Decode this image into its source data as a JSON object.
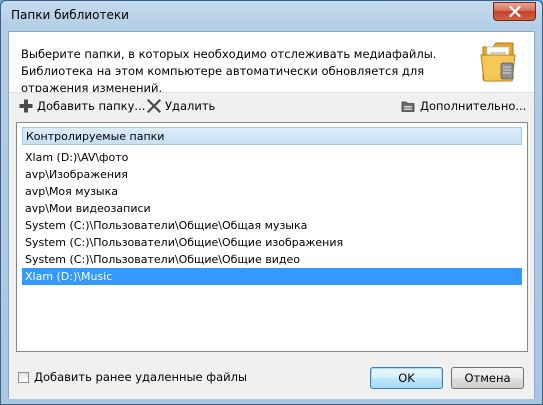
{
  "window": {
    "title": "Папки библиотеки"
  },
  "header": {
    "description": "Выберите папки, в которых необходимо отслеживать медиафайлы. Библиотека на этом компьютере автоматически обновляется для отражения изменений."
  },
  "toolbar": {
    "add_label": "Добавить папку...",
    "remove_label": "Удалить",
    "advanced_label": "Дополнительно..."
  },
  "list": {
    "header": "Контролируемые папки",
    "items": [
      "Xlam (D:)\\AV\\фото",
      "avp\\Изображения",
      "avp\\Моя музыка",
      "avp\\Мои видеозаписи",
      "System (C:)\\Пользователи\\Общие\\Общая музыка",
      "System (C:)\\Пользователи\\Общие\\Общие изображения",
      "System (C:)\\Пользователи\\Общие\\Общие видео",
      "Xlam (D:)\\Music"
    ],
    "selected_index": 7
  },
  "footer": {
    "checkbox_label": "Добавить ранее удаленные файлы",
    "checkbox_checked": false,
    "ok_label": "OK",
    "cancel_label": "Отмена"
  },
  "colors": {
    "selection": "#3399ff",
    "close_button": "#c4412c"
  },
  "icons": {
    "close": "close-icon",
    "add": "plus-icon",
    "remove": "x-icon",
    "advanced": "folder-settings-icon",
    "library": "folder-icon"
  }
}
